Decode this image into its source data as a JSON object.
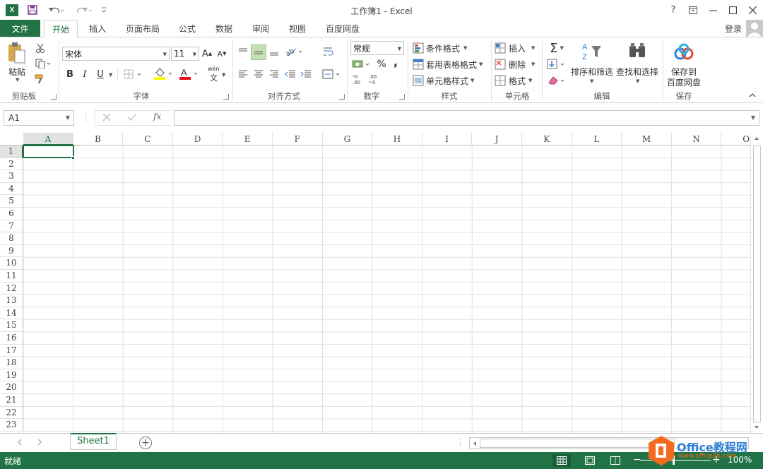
{
  "window": {
    "title": "工作簿1 - Excel",
    "app_badge": "X",
    "controls": {
      "help": "?",
      "ribbon_options": "⊡",
      "minimize": "—",
      "maximize": "☐",
      "close": "✕"
    }
  },
  "tabs": {
    "file": "文件",
    "items": [
      "开始",
      "插入",
      "页面布局",
      "公式",
      "数据",
      "审阅",
      "视图",
      "百度网盘"
    ],
    "active": "开始",
    "login": "登录"
  },
  "ribbon": {
    "clipboard": {
      "paste": "粘贴",
      "group": "剪贴板"
    },
    "font": {
      "name": "宋体",
      "size": "11",
      "bold": "B",
      "italic": "I",
      "underline": "U",
      "group": "字体",
      "grow": "A",
      "shrink": "A",
      "pinyin": "wén",
      "pinyin_char": "文"
    },
    "alignment": {
      "group": "对齐方式"
    },
    "number": {
      "format": "常规",
      "percent": "%",
      "comma": ",",
      "group": "数字"
    },
    "styles": {
      "conditional": "条件格式",
      "table": "套用表格格式",
      "cell_styles": "单元格样式",
      "group": "样式"
    },
    "cells": {
      "insert": "插入",
      "delete": "删除",
      "format": "格式",
      "group": "单元格"
    },
    "editing": {
      "sort_filter": "排序和筛选",
      "find_select": "查找和选择",
      "group": "编辑"
    },
    "save": {
      "label_line1": "保存到",
      "label_line2": "百度网盘",
      "group": "保存"
    }
  },
  "formula_bar": {
    "name_box": "A1",
    "fx": "fx",
    "value": ""
  },
  "grid": {
    "columns": [
      "A",
      "B",
      "C",
      "D",
      "E",
      "F",
      "G",
      "H",
      "I",
      "J",
      "K",
      "L",
      "M",
      "N",
      "O"
    ],
    "rows": [
      "1",
      "2",
      "3",
      "4",
      "5",
      "6",
      "7",
      "8",
      "9",
      "10",
      "11",
      "12",
      "13",
      "14",
      "15",
      "16",
      "17",
      "18",
      "19",
      "20",
      "21",
      "22",
      "23"
    ],
    "selected_cell": "A1"
  },
  "sheets": {
    "tabs": [
      "Sheet1"
    ],
    "active": "Sheet1",
    "add": "+"
  },
  "status": {
    "text": "就绪",
    "zoom": "100%"
  },
  "watermark": {
    "text": "Office教程网",
    "url": "www.office26.com"
  },
  "colors": {
    "accent": "#217346",
    "watermark_orange": "#f26b1d"
  }
}
